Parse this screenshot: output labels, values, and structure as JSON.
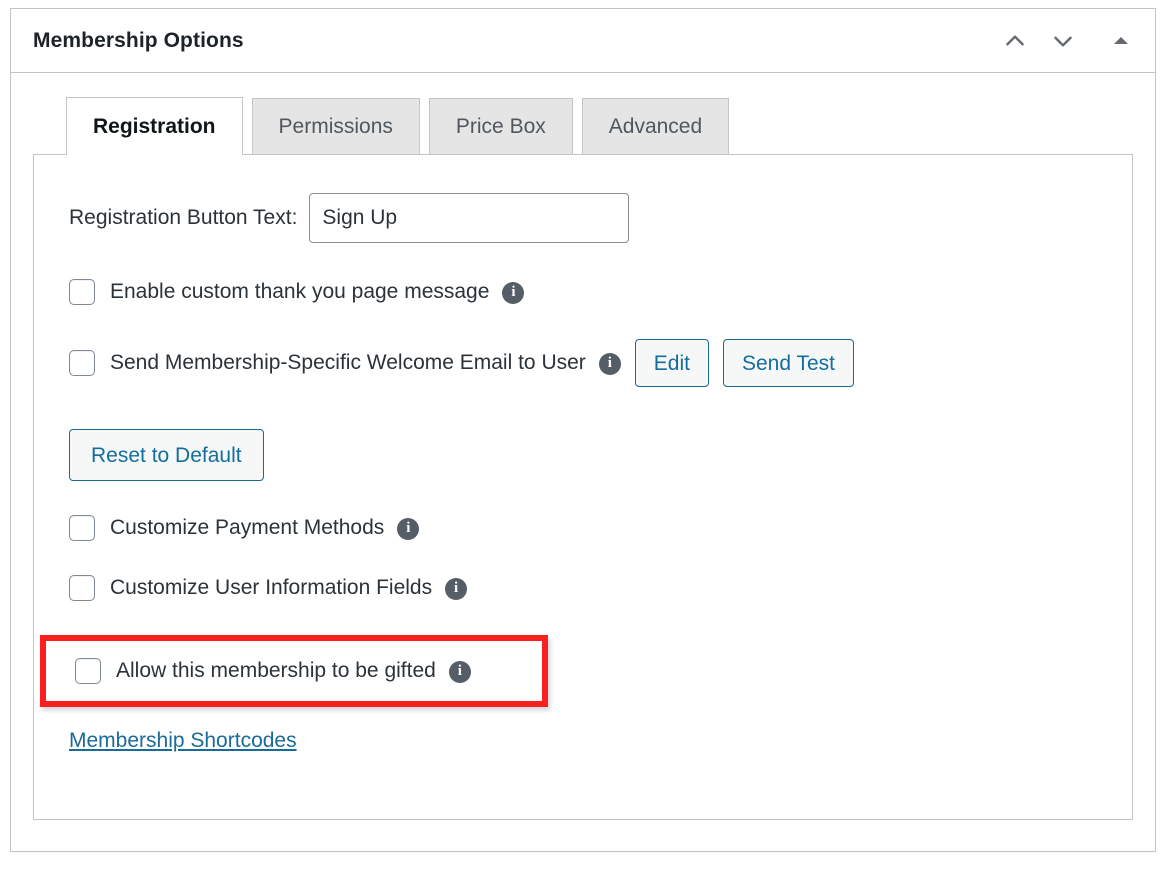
{
  "panel": {
    "title": "Membership Options",
    "header_actions": [
      {
        "name": "move-up",
        "icon": "chevron-up-icon"
      },
      {
        "name": "move-down",
        "icon": "chevron-down-icon"
      },
      {
        "name": "toggle-panel",
        "icon": "triangle-up-icon"
      }
    ]
  },
  "tabs": [
    {
      "label": "Registration",
      "active": true
    },
    {
      "label": "Permissions",
      "active": false
    },
    {
      "label": "Price Box",
      "active": false
    },
    {
      "label": "Advanced",
      "active": false
    }
  ],
  "registration": {
    "button_text_label": "Registration Button Text:",
    "button_text_value": "Sign Up",
    "button_text_placeholder": "",
    "options": [
      {
        "label": "Enable custom thank you page message",
        "checked": false,
        "info": "info-icon"
      },
      {
        "label": "Send Membership-Specific Welcome Email to User",
        "checked": false,
        "info": "info-icon",
        "buttons": [
          {
            "label": "Edit"
          },
          {
            "label": "Send Test"
          }
        ],
        "secondary_button": {
          "label": "Reset to Default"
        }
      },
      {
        "label": "Customize Payment Methods",
        "checked": false,
        "info": "info-icon"
      },
      {
        "label": "Customize User Information Fields",
        "checked": false,
        "info": "info-icon"
      },
      {
        "label": "Allow this membership to be gifted",
        "checked": false,
        "info": "info-icon",
        "highlighted": true
      }
    ],
    "shortcodes_link": "Membership Shortcodes"
  },
  "colors": {
    "accent_link": "#1a6b9a",
    "button_border": "#1a6b8f",
    "highlight": "#fa2020",
    "info_icon": "#555d66",
    "panel_border": "#c3c4c7",
    "tab_inactive_bg": "#e5e5e5"
  },
  "icons": {
    "info": "i"
  }
}
